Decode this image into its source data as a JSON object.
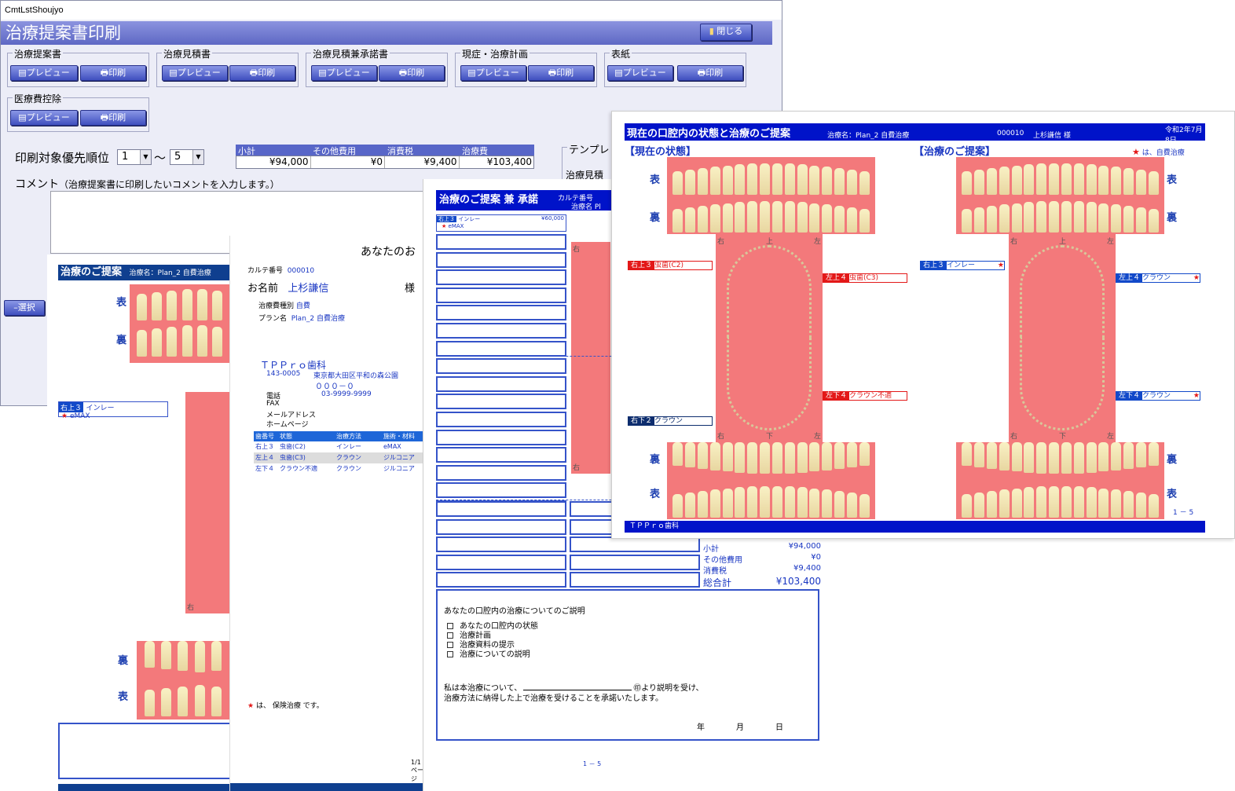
{
  "window": {
    "title": "CmtLstShoujyo",
    "header": "治療提案書印刷",
    "close_label": "閉じる",
    "groups": [
      {
        "title": "治療提案書",
        "preview": "プレビュー",
        "print": "印刷"
      },
      {
        "title": "治療見積書",
        "preview": "プレビュー",
        "print": "印刷"
      },
      {
        "title": "治療見積兼承諾書",
        "preview": "プレビュー",
        "print": "印刷"
      },
      {
        "title": "現症・治療計画",
        "preview": "プレビュー",
        "print": "印刷"
      },
      {
        "title": "表紙",
        "preview": "プレビュー",
        "print": "印刷"
      },
      {
        "title": "医療費控除",
        "preview": "プレビュー",
        "print": "印刷"
      }
    ],
    "priority_label": "印刷対象優先順位",
    "priority_from": "1",
    "priority_tilde": "～",
    "priority_to": "5",
    "totals_headers": [
      "小計",
      "その他費用",
      "消費税",
      "治療費"
    ],
    "totals_values": [
      "¥94,000",
      "¥0",
      "¥9,400",
      "¥103,400"
    ],
    "template_label": "テンプレ",
    "template_item": "治療見積",
    "comment_label": "コメント",
    "comment_hint": "（治療提案書に印刷したいコメントを入力します。）",
    "select_label": "選択"
  },
  "doc1": {
    "title": "治療のご提案",
    "plan": "治療名：Plan_2 自費治療",
    "front": "表",
    "back": "裏",
    "label_tooth": "右上３",
    "label_treat": "インレー",
    "label_mat": "eMAX",
    "right_mark": "右"
  },
  "doc2": {
    "heading": "あなたのお",
    "karte_label": "カルテ番号",
    "karte_no": "000010",
    "name_label": "お名前",
    "name": "上杉謙信",
    "sama": "様",
    "kind_label": "治療費種別",
    "kind": "自費",
    "plan_label": "プラン名",
    "plan": "Plan_2 自費治療",
    "clinic": "ＴＰＰｒｏ歯科",
    "zip": "143-0005",
    "addr1": "東京都大田区平和の森公園",
    "addr2": "０００－０",
    "tel_label": "電話",
    "tel": "03-9999-9999",
    "fax_label": "FAX",
    "mail_label": "メールアドレス",
    "hp_label": "ホームページ",
    "table_headers": [
      "歯番号",
      "状態",
      "治療方法",
      "施術・材料"
    ],
    "rows": [
      [
        "右上３",
        "虫歯(C2)",
        "インレー",
        "eMAX"
      ],
      [
        "左上４",
        "虫歯(C3)",
        "クラウン",
        "ジルコニア"
      ],
      [
        "左下４",
        "クラウン不適",
        "クラウン",
        "ジルコニア"
      ]
    ],
    "star_note": "は、 保険治療 です。",
    "page": "1/1 ページ"
  },
  "doc3": {
    "title": "治療のご提案 兼 承諾",
    "karte_label": "カルテ番号",
    "plan_label": "治療名",
    "plan_short": "Pl",
    "row_tooth": "右上３",
    "row_treat": "インレー",
    "row_price": "¥60,000",
    "row_mat": "eMAX",
    "right_mark": "右",
    "sum_labels": [
      "小計",
      "その他費用",
      "消費税",
      "総合計"
    ],
    "sum_values": [
      "¥94,000",
      "¥0",
      "¥9,400",
      "¥103,400"
    ],
    "explain_title": "あなたの口腔内の治療についてのご説明",
    "checks": [
      "あなたの口腔内の状態",
      "治療計画",
      "治療資料の提示",
      "治療についての説明"
    ],
    "consent1": "私は本治療について、",
    "consent1b": "㊞より説明を受け、",
    "consent2": "治療方法に納得した上で治療を受けることを承諾いたします。",
    "date": [
      "年",
      "月",
      "日"
    ],
    "page": "1 － 5"
  },
  "doc4": {
    "title": "現在の口腔内の状態と治療のご提案",
    "plan": "治療名：Plan_2 自費治療",
    "karte": "000010",
    "name": "上杉謙信 様",
    "date": "令和2年7月8日",
    "current_head": "【現在の状態】",
    "proposal_head": "【治療のご提案】",
    "star_note": "は、自費治療",
    "front": "表",
    "back": "裏",
    "arch_marks": [
      "右",
      "上",
      "左",
      "右",
      "下",
      "左"
    ],
    "labels_current": [
      {
        "tooth": "右上３",
        "text": "虫歯(C2)"
      },
      {
        "tooth": "左上４",
        "text": "虫歯(C3)"
      },
      {
        "tooth": "左下４",
        "text": "クラウン不適"
      },
      {
        "tooth": "右下２",
        "text": "クラウン"
      }
    ],
    "labels_proposal": [
      {
        "tooth": "右上３",
        "text": "インレー"
      },
      {
        "tooth": "左上４",
        "text": "クラウン"
      },
      {
        "tooth": "左下４",
        "text": "クラウン"
      }
    ],
    "page": "1 － 5",
    "footer": "ＴＰＰｒｏ歯科"
  },
  "colors": {
    "accent": "#0013c9",
    "navy": "#0f3f8f",
    "red": "#e31818",
    "gum": "#f3797b"
  }
}
